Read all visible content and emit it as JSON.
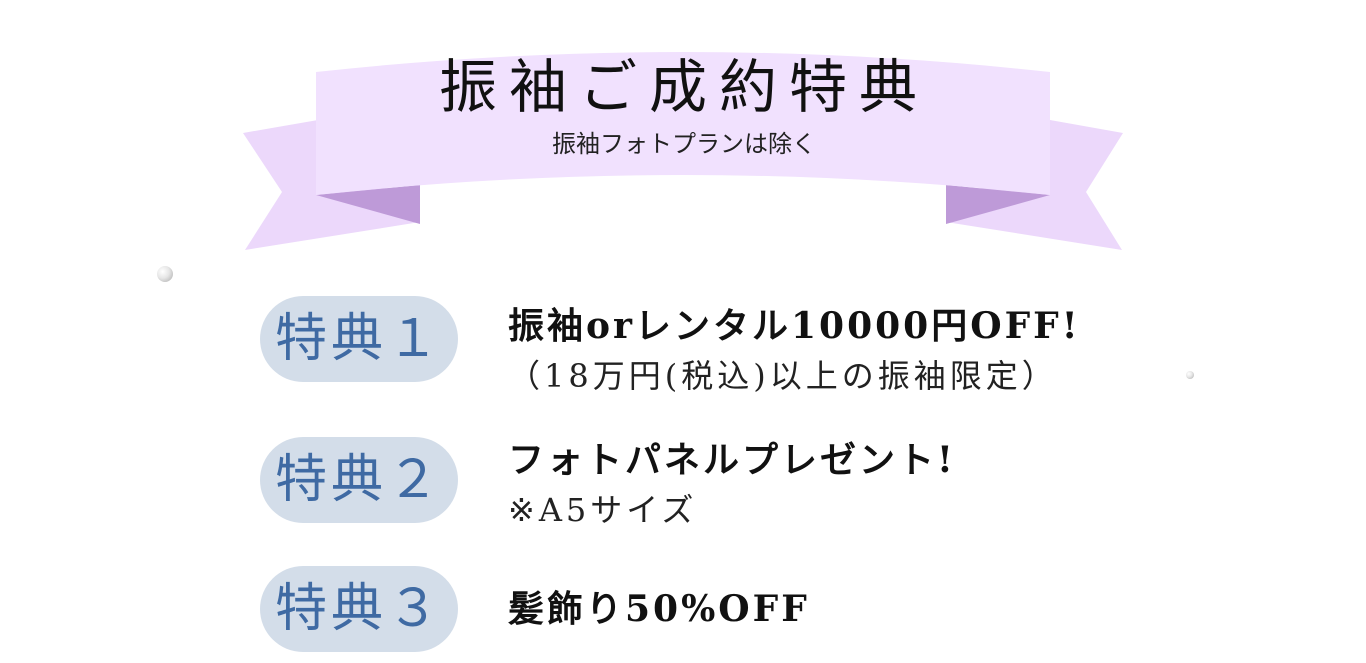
{
  "banner": {
    "title": "振袖ご成約特典",
    "subtitle": "振袖フォトプランは除く"
  },
  "colors": {
    "ribbon_light": "#f1e1fe",
    "ribbon_mid": "#e9cdf6",
    "ribbon_dark": "#be9ad8",
    "badge_bg": "#d3dde9",
    "badge_text": "#3f6aa3"
  },
  "benefits": [
    {
      "badge": "特典１",
      "main": "振袖orレンタル10000円OFF!",
      "sub": "（18万円(税込)以上の振袖限定）"
    },
    {
      "badge": "特典２",
      "main": "フォトパネルプレゼント!",
      "sub": "※A5サイズ"
    },
    {
      "badge": "特典３",
      "main": "髪飾り50%OFF"
    }
  ]
}
